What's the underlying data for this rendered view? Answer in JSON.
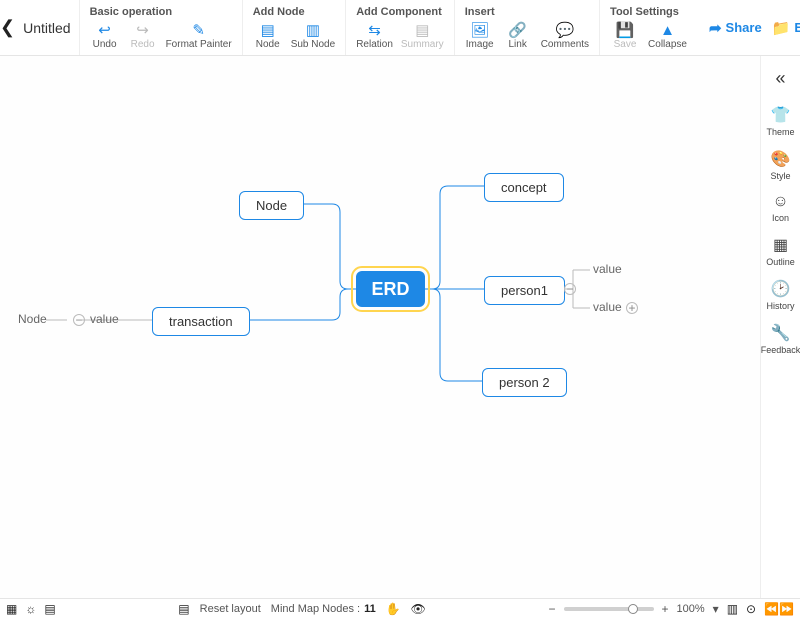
{
  "title": "Untitled",
  "toolbar": {
    "basic": {
      "label": "Basic operation",
      "undo": "Undo",
      "redo": "Redo",
      "format_painter": "Format Painter"
    },
    "add_node": {
      "label": "Add Node",
      "node": "Node",
      "sub_node": "Sub Node"
    },
    "add_component": {
      "label": "Add Component",
      "relation": "Relation",
      "summary": "Summary"
    },
    "insert": {
      "label": "Insert",
      "image": "Image",
      "link": "Link",
      "comments": "Comments"
    },
    "tool_settings": {
      "label": "Tool Settings",
      "save": "Save",
      "collapse": "Collapse"
    }
  },
  "actions": {
    "share": "Share",
    "export": "Export"
  },
  "side": {
    "theme": "Theme",
    "style": "Style",
    "icon": "Icon",
    "outline": "Outline",
    "history": "History",
    "feedback": "Feedback"
  },
  "nodes": {
    "center": "ERD",
    "node": "Node",
    "transaction": "transaction",
    "concept": "concept",
    "person1": "person1",
    "person2": "person 2",
    "leaf_node": "Node",
    "leaf_value": "value",
    "p1_value1": "value",
    "p1_value2": "value"
  },
  "status": {
    "reset_layout": "Reset layout",
    "nodes_label": "Mind Map Nodes :",
    "nodes_count": "11",
    "zoom": "100%"
  }
}
